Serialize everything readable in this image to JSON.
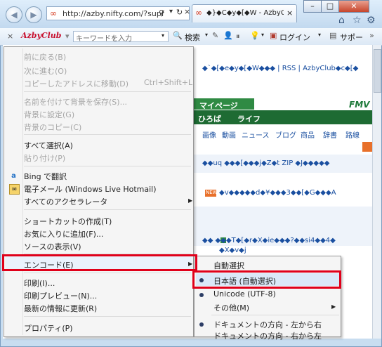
{
  "browser": {
    "address": "http://azby.nifty.com/?supf",
    "tab_title": "◆}◆C◆y◆[◆W - AzbyClub...",
    "toolbar": {
      "close_x": "×",
      "brand": "AzbyClub",
      "search_placeholder": "キーワードを入力",
      "search_label": "検索",
      "login_label": "ログイン",
      "support_label": "サポー"
    }
  },
  "page": {
    "rss_line": "◆`◆[◆e◆y◆[◆W◆◆◆ | RSS | AzbyClub◆c◆[◆",
    "tab_mypage": "マイページ",
    "tab_hiroba": "ひろば",
    "tab_life": "ライフ",
    "brand_right": "FMV",
    "nav_links": [
      "画像",
      "動画",
      "ニュース",
      "ブログ",
      "商品",
      "辞書",
      "路線"
    ],
    "garbled_1": "◆◆uq  ◆◆◆[◆◆◆j◆Z◆t  ZIP  ◆J◆◆◆◆◆",
    "garbled_2": "◆v◆◆◆◆◆d◆¥◆◆◆3◆◆[◆G◆◆◆A",
    "garbled_3": "◆◆  ◆◆◆T◆[◆r◆X◆ie◆◆◆?◆◆si4◆◆4◆",
    "garbled_4": "◆X◆v◆j",
    "badge_new": "NEW"
  },
  "context_menu": {
    "items": [
      {
        "label": "前に戻る(B)",
        "disabled": true
      },
      {
        "label": "次に進む(O)",
        "disabled": true
      },
      {
        "label": "コピーしたアドレスに移動(D)",
        "disabled": true,
        "shortcut": "Ctrl+Shift+L"
      },
      {
        "label": "名前を付けて背景を保存(S)...",
        "disabled": true
      },
      {
        "label": "背景に設定(G)",
        "disabled": true
      },
      {
        "label": "背景のコピー(C)",
        "disabled": true
      },
      {
        "label": "すべて選択(A)",
        "disabled": false
      },
      {
        "label": "貼り付け(P)",
        "disabled": true
      },
      {
        "label": "Bing で翻訳",
        "disabled": false
      },
      {
        "label": "電子メール (Windows Live Hotmail)",
        "disabled": false
      },
      {
        "label": "すべてのアクセラレータ",
        "disabled": false
      },
      {
        "label": "ショートカットの作成(T)",
        "disabled": false
      },
      {
        "label": "お気に入りに追加(F)...",
        "disabled": false
      },
      {
        "label": "ソースの表示(V)",
        "disabled": false
      },
      {
        "label": "エンコード(E)",
        "disabled": false
      },
      {
        "label": "印刷(I)...",
        "disabled": false
      },
      {
        "label": "印刷プレビュー(N)...",
        "disabled": false
      },
      {
        "label": "最新の情報に更新(R)",
        "disabled": false
      },
      {
        "label": "プロパティ(P)",
        "disabled": false
      }
    ]
  },
  "encoding_submenu": {
    "items": [
      {
        "label": "自動選択"
      },
      {
        "label": "日本語 (自動選択)"
      },
      {
        "label": "Unicode (UTF-8)"
      },
      {
        "label": "その他(M)"
      },
      {
        "label": "ドキュメントの方向 - 左から右"
      },
      {
        "label": "ドキュメントの方向 - 右から左"
      }
    ]
  },
  "colors": {
    "highlight": "#e0001a",
    "green_tab": "#1e7a3a"
  }
}
